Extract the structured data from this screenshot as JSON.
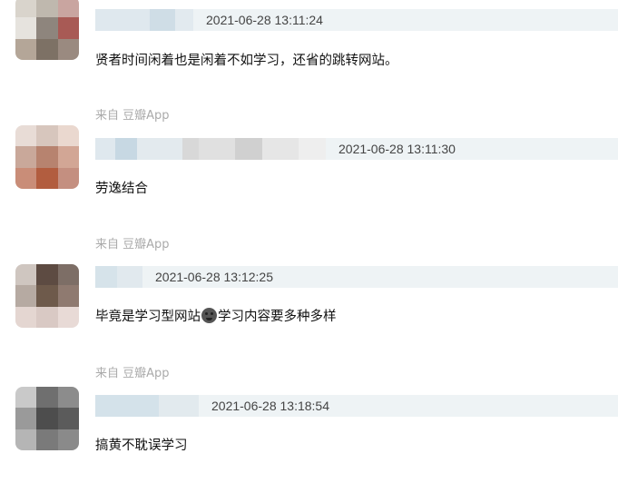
{
  "comments": [
    {
      "username": "",
      "timestamp": "2021-06-28 13:11:24",
      "text": "贤者时间闲着也是闲着不如学习，还省的跳转网站。",
      "source": "",
      "avatar_colors": [
        "#d9d4cc",
        "#bfb8ae",
        "#c9a5a0",
        "#e6e3de",
        "#8e857d",
        "#a85a55",
        "#b4a698",
        "#7d7165",
        "#9a8a80"
      ]
    },
    {
      "username": "",
      "timestamp": "2021-06-28 13:11:30",
      "text": "劳逸结合",
      "source": "来自 豆瓣App",
      "avatar_colors": [
        "#e8dcd6",
        "#d7c6bd",
        "#ead8cf",
        "#c9a89a",
        "#b7836f",
        "#d2a695",
        "#c98d78",
        "#b25d3f",
        "#c48f80"
      ]
    },
    {
      "username": "",
      "timestamp": "2021-06-28 13:12:25",
      "text_before": "毕竟是学习型网站",
      "emoji": "face-emoji",
      "text_after": "学习内容要多种多样",
      "source": "来自 豆瓣App",
      "avatar_colors": [
        "#cfc6c0",
        "#5d4b42",
        "#7d6e66",
        "#b6aaa2",
        "#6e5a4b",
        "#8f7a70",
        "#e4d6d1",
        "#d9c9c4",
        "#e8dad6"
      ]
    },
    {
      "username": "",
      "timestamp": "2021-06-28 13:18:54",
      "text": "搞黄不耽误学习",
      "source": "来自 豆瓣App",
      "avatar_colors": [
        "#c9c9c9",
        "#6f6f6f",
        "#8c8c8c",
        "#9a9a9a",
        "#4d4d4d",
        "#5b5b5b",
        "#b5b5b5",
        "#7a7a7a",
        "#8a8a8a"
      ]
    }
  ]
}
